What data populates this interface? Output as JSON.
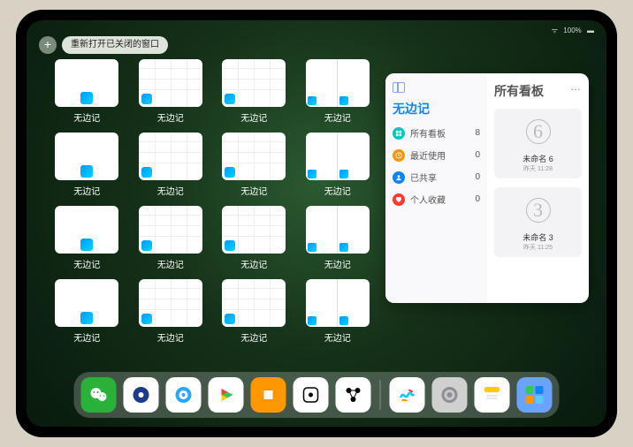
{
  "statusbar": {
    "time": "",
    "wifi": "􀙇",
    "battery_pct": "100%"
  },
  "topbar": {
    "plus": "+",
    "reopen_label": "重新打开已关闭的窗口"
  },
  "app_label": "无边记",
  "thumbs": [
    {
      "style": "blank"
    },
    {
      "style": "cal"
    },
    {
      "style": "cal"
    },
    {
      "style": "split"
    },
    {
      "style": "blank"
    },
    {
      "style": "cal"
    },
    {
      "style": "cal"
    },
    {
      "style": "split"
    },
    {
      "style": "blank"
    },
    {
      "style": "cal"
    },
    {
      "style": "cal"
    },
    {
      "style": "split"
    },
    {
      "style": "blank"
    },
    {
      "style": "cal"
    },
    {
      "style": "cal"
    },
    {
      "style": "split"
    }
  ],
  "panel": {
    "left_title": "无边记",
    "right_title": "所有看板",
    "rows": [
      {
        "color": "#00c7c2",
        "icon": "grid",
        "label": "所有看板",
        "count": "8"
      },
      {
        "color": "#ff9500",
        "icon": "clock",
        "label": "最近使用",
        "count": "0"
      },
      {
        "color": "#0a84ff",
        "icon": "person",
        "label": "已共享",
        "count": "0"
      },
      {
        "color": "#ff3b30",
        "icon": "heart",
        "label": "个人收藏",
        "count": "0"
      }
    ],
    "cards": [
      {
        "glyph": "6",
        "title": "未命名 6",
        "subtitle": "昨天 11:28"
      },
      {
        "glyph": "3",
        "title": "未命名 3",
        "subtitle": "昨天 11:25"
      }
    ],
    "more": "…"
  },
  "dock": [
    {
      "name": "wechat",
      "bg": "#29b13a"
    },
    {
      "name": "video",
      "bg": "#ffffff"
    },
    {
      "name": "browser",
      "bg": "#ffffff"
    },
    {
      "name": "play",
      "bg": "#ffffff"
    },
    {
      "name": "books",
      "bg": "#ff9800"
    },
    {
      "name": "dice",
      "bg": "#ffffff"
    },
    {
      "name": "nodes",
      "bg": "#ffffff"
    },
    {
      "name": "sep"
    },
    {
      "name": "freeform",
      "bg": "#ffffff"
    },
    {
      "name": "settings",
      "bg": "#d0d0d0"
    },
    {
      "name": "notes",
      "bg": "#ffffff"
    },
    {
      "name": "folder",
      "bg": "#6aa2ff"
    }
  ]
}
